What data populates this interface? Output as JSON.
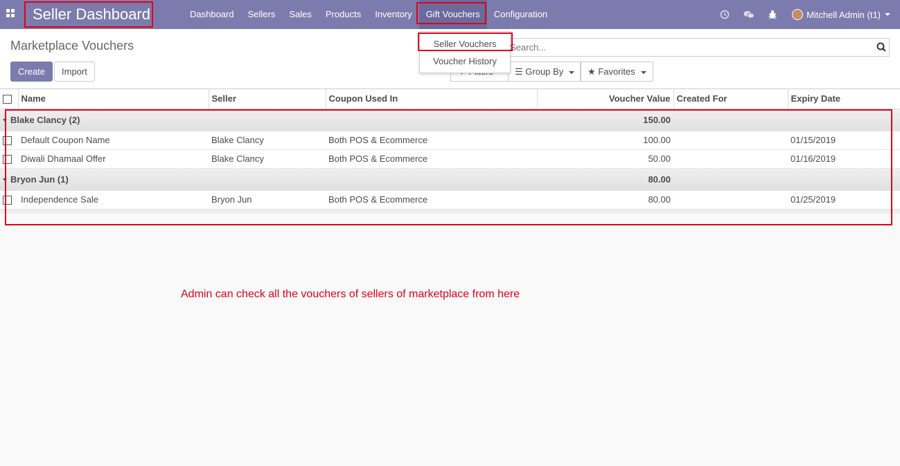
{
  "navbar": {
    "brand": "Seller Dashboard",
    "menu": [
      "Dashboard",
      "Sellers",
      "Sales",
      "Products",
      "Inventory",
      "Gift Vouchers",
      "Configuration"
    ],
    "active_menu": "Gift Vouchers",
    "user": "Mitchell Admin (t1)",
    "icons": [
      "apps-icon",
      "clock-icon",
      "chat-icon",
      "bug-icon"
    ]
  },
  "dropdown": {
    "items": [
      "Seller Vouchers",
      "Voucher History"
    ]
  },
  "control": {
    "title": "Marketplace Vouchers",
    "create_label": "Create",
    "import_label": "Import",
    "search_placeholder": "Search...",
    "filters_label": "Filters",
    "groupby_label": "Group By",
    "favorites_label": "Favorites"
  },
  "table": {
    "columns": [
      "Name",
      "Seller",
      "Coupon Used In",
      "Voucher Value",
      "Created For",
      "Expiry Date"
    ],
    "groups": [
      {
        "label": "Blake Clancy (2)",
        "total": "150.00",
        "rows": [
          {
            "name": "Default Coupon Name",
            "seller": "Blake Clancy",
            "coupon": "Both POS & Ecommerce",
            "value": "100.00",
            "created_for": "",
            "expiry": "01/15/2019"
          },
          {
            "name": "Diwali Dhamaal Offer",
            "seller": "Blake Clancy",
            "coupon": "Both POS & Ecommerce",
            "value": "50.00",
            "created_for": "",
            "expiry": "01/16/2019"
          }
        ]
      },
      {
        "label": "Bryon Jun (1)",
        "total": "80.00",
        "rows": [
          {
            "name": "Independence Sale",
            "seller": "Bryon Jun",
            "coupon": "Both POS & Ecommerce",
            "value": "80.00",
            "created_for": "",
            "expiry": "01/25/2019"
          }
        ]
      }
    ]
  },
  "annotation": "Admin can check all the vouchers of sellers of marketplace from here",
  "colors": {
    "navbar": "#7c7bad",
    "highlight": "#e0001b"
  }
}
